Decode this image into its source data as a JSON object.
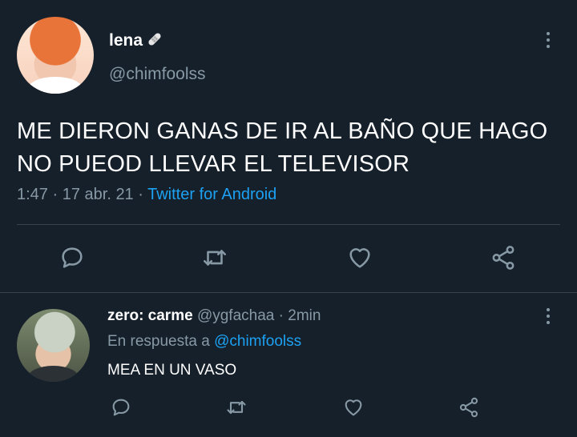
{
  "main_tweet": {
    "display_name": "lena",
    "handle": "@chimfoolss",
    "text_line1": "ME DIERON GANAS DE IR AL BAÑO QUE HAGO",
    "text_line2": "NO PUEOD LLEVAR EL TELEVISOR",
    "time": "1:47",
    "date": "17 abr. 21",
    "source": "Twitter for Android"
  },
  "reply_tweet": {
    "display_name": "zero: carme",
    "handle": "@ygfachaa",
    "age": "2min",
    "reply_prefix": "En respuesta a",
    "reply_to": "@chimfoolss",
    "text": "MEA EN UN VASO"
  },
  "colors": {
    "background": "#15202b",
    "secondary_text": "#8899a6",
    "link": "#1da1f2",
    "divider": "#38444d"
  },
  "icons": [
    "reply-icon",
    "retweet-icon",
    "like-icon",
    "share-icon",
    "more-options-icon",
    "verified-style-badge-icon"
  ]
}
